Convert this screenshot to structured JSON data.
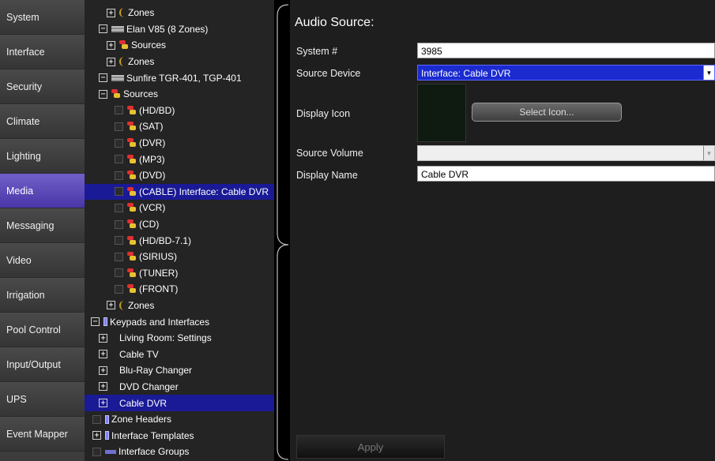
{
  "sidebar": {
    "items": [
      {
        "label": "System",
        "active": false
      },
      {
        "label": "Interface",
        "active": false
      },
      {
        "label": "Security",
        "active": false
      },
      {
        "label": "Climate",
        "active": false
      },
      {
        "label": "Lighting",
        "active": false
      },
      {
        "label": "Media",
        "active": true
      },
      {
        "label": "Messaging",
        "active": false
      },
      {
        "label": "Video",
        "active": false
      },
      {
        "label": "Irrigation",
        "active": false
      },
      {
        "label": "Pool Control",
        "active": false
      },
      {
        "label": "Input/Output",
        "active": false
      },
      {
        "label": "UPS",
        "active": false
      },
      {
        "label": "Event Mapper",
        "active": false
      }
    ]
  },
  "tree": {
    "rows": [
      {
        "label": "Zones",
        "toggle": "+",
        "icon": "zone-icon"
      },
      {
        "label": "Elan V85 (8 Zones)",
        "toggle": "−",
        "icon": "device-icon"
      },
      {
        "label": "Sources",
        "toggle": "+",
        "icon": "source-icon"
      },
      {
        "label": "Zones",
        "toggle": "+",
        "icon": "zone-icon"
      },
      {
        "label": "Sunfire TGR-401, TGP-401",
        "toggle": "−",
        "icon": "device-icon"
      },
      {
        "label": "Sources",
        "toggle": "−",
        "icon": "source-icon"
      },
      {
        "label": "(HD/BD)",
        "icon": "source-icon"
      },
      {
        "label": "(SAT)",
        "icon": "source-icon"
      },
      {
        "label": "(DVR)",
        "icon": "source-icon"
      },
      {
        "label": "(MP3)",
        "icon": "source-icon"
      },
      {
        "label": "(DVD)",
        "icon": "source-icon"
      },
      {
        "label": "(CABLE) Interface: Cable DVR",
        "icon": "source-icon",
        "selected": true
      },
      {
        "label": "(VCR)",
        "icon": "source-icon"
      },
      {
        "label": "(CD)",
        "icon": "source-icon"
      },
      {
        "label": "(HD/BD-7.1)",
        "icon": "source-icon"
      },
      {
        "label": "(SIRIUS)",
        "icon": "source-icon"
      },
      {
        "label": "(TUNER)",
        "icon": "source-icon"
      },
      {
        "label": "(FRONT)",
        "icon": "source-icon"
      },
      {
        "label": "Zones",
        "toggle": "+",
        "icon": "zone-icon"
      },
      {
        "label": "Keypads and Interfaces",
        "toggle": "−",
        "icon": "keypad-icon"
      },
      {
        "label": "Living Room: Settings",
        "toggle": "+"
      },
      {
        "label": "Cable TV",
        "toggle": "+"
      },
      {
        "label": "Blu-Ray Changer",
        "toggle": "+"
      },
      {
        "label": "DVD Changer",
        "toggle": "+"
      },
      {
        "label": "Cable DVR",
        "toggle": "+",
        "selected": true
      },
      {
        "label": "Zone Headers",
        "icon": "keypad-icon"
      },
      {
        "label": "Interface Templates",
        "toggle": "+",
        "icon": "keypad-icon"
      },
      {
        "label": "Interface Groups",
        "icon": "group-icon"
      }
    ]
  },
  "content": {
    "title": "Audio Source:",
    "system_number_label": "System #",
    "system_number_value": "3985",
    "source_device_label": "Source Device",
    "source_device_value": "Interface: Cable DVR",
    "display_icon_label": "Display Icon",
    "select_icon_label": "Select Icon...",
    "source_volume_label": "Source Volume",
    "source_volume_value": "",
    "display_name_label": "Display Name",
    "display_name_value": "Cable DVR",
    "apply_label": "Apply"
  }
}
